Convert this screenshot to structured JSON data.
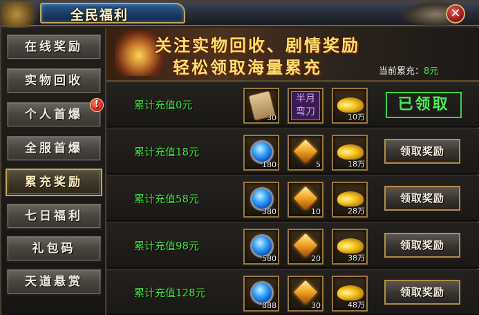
{
  "window": {
    "title": "全民福利"
  },
  "sidebar": {
    "items": [
      {
        "label": "在线奖励",
        "badge": ""
      },
      {
        "label": "实物回收",
        "badge": ""
      },
      {
        "label": "个人首爆",
        "badge": "!"
      },
      {
        "label": "全服首爆",
        "badge": ""
      },
      {
        "label": "累充奖励",
        "badge": ""
      },
      {
        "label": "七日福利",
        "badge": ""
      },
      {
        "label": "礼包码",
        "badge": ""
      },
      {
        "label": "天道悬赏",
        "badge": ""
      }
    ],
    "active": "累充奖励"
  },
  "banner": {
    "line1": "关注实物回收、剧情奖励",
    "line2": "轻松领取海量累充",
    "recharge_label": "当前累充：",
    "recharge_value": "8元"
  },
  "rows": [
    {
      "label": "累计充值0元",
      "items": [
        {
          "icon": "scroll-icon",
          "count": "30",
          "text": ""
        },
        {
          "icon": "blade-box-icon",
          "count": "",
          "text_line1": "半月",
          "text_line2": "弯刀"
        },
        {
          "icon": "gold-ingot-icon",
          "count": "10万"
        }
      ],
      "status": "已领取"
    },
    {
      "label": "累计充值18元",
      "items": [
        {
          "icon": "blue-gem-icon",
          "count": "180"
        },
        {
          "icon": "gold-gem-icon",
          "count": "5"
        },
        {
          "icon": "gold-ingot-icon",
          "count": "18万"
        }
      ],
      "button": "领取奖励"
    },
    {
      "label": "累计充值58元",
      "items": [
        {
          "icon": "blue-gem-icon",
          "count": "380"
        },
        {
          "icon": "gold-gem-icon",
          "count": "10"
        },
        {
          "icon": "gold-ingot-icon",
          "count": "28万"
        }
      ],
      "button": "领取奖励"
    },
    {
      "label": "累计充值98元",
      "items": [
        {
          "icon": "blue-gem-icon",
          "count": "580"
        },
        {
          "icon": "gold-gem-icon",
          "count": "20"
        },
        {
          "icon": "gold-ingot-icon",
          "count": "38万"
        }
      ],
      "button": "领取奖励"
    },
    {
      "label": "累计充值128元",
      "items": [
        {
          "icon": "blue-gem-icon",
          "count": "888"
        },
        {
          "icon": "gold-gem-icon",
          "count": "30"
        },
        {
          "icon": "gold-ingot-icon",
          "count": "48万"
        }
      ],
      "button": "领取奖励"
    }
  ],
  "colors": {
    "accent_gold": "#c9a45a",
    "green_text": "#3ee23e",
    "close_red": "#a51d1d"
  }
}
